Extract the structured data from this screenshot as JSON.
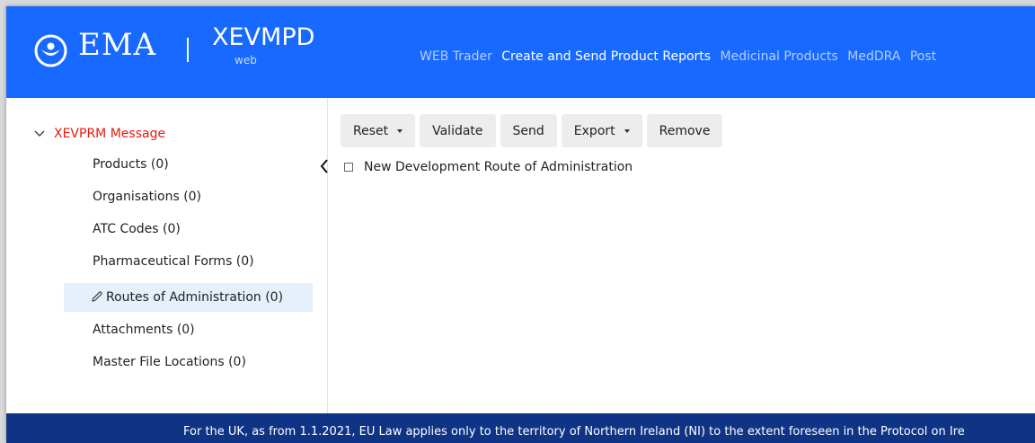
{
  "header": {
    "brand": "EMA",
    "product": "XEVMPD",
    "product_sub": "web",
    "logo_icon": "ema-logo-icon",
    "background": "#1769ff",
    "nav": [
      {
        "label": "WEB Trader",
        "active": false
      },
      {
        "label": "Create and Send Product Reports",
        "active": true
      },
      {
        "label": "Medicinal Products",
        "active": false
      },
      {
        "label": "MedDRA",
        "active": false
      },
      {
        "label": "Post",
        "active": false
      }
    ]
  },
  "sidebar": {
    "root": {
      "label": "XEVPRM Message",
      "icon": "chevron-down-icon",
      "color": "#e8190b"
    },
    "items": [
      {
        "label": "Products (0)"
      },
      {
        "label": "Organisations (0)"
      },
      {
        "label": "ATC Codes (0)"
      },
      {
        "label": "Pharmaceutical Forms (0)"
      },
      {
        "label": "Routes of Administration (0)",
        "selected": true,
        "icon": "pencil-icon"
      },
      {
        "label": "Attachments (0)"
      },
      {
        "label": "Master File Locations (0)"
      }
    ],
    "collapse_icon": "chevron-left-icon"
  },
  "toolbar": {
    "reset_label": "Reset",
    "validate_label": "Validate",
    "send_label": "Send",
    "export_label": "Export",
    "remove_label": "Remove"
  },
  "content": {
    "checkbox_label": "New Development Route of Administration",
    "checked": false
  },
  "footer": {
    "text": "For the UK, as from 1.1.2021, EU Law applies only to the territory of Northern Ireland (NI) to the extent foreseen in the Protocol on Ire",
    "background": "#0f3486"
  }
}
